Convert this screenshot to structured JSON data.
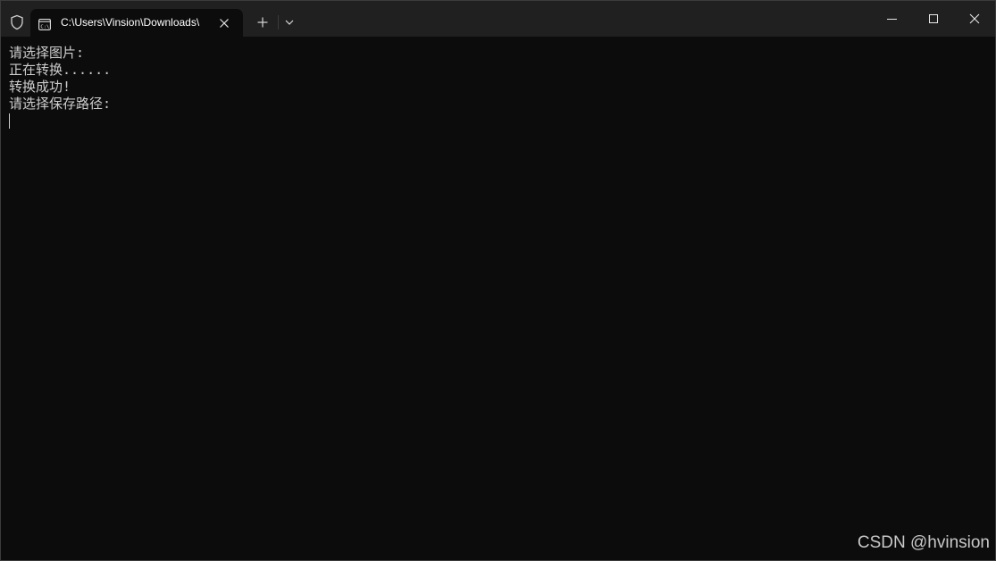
{
  "tab": {
    "title": "C:\\Users\\Vinsion\\Downloads\\"
  },
  "terminal": {
    "lines": [
      "请选择图片:",
      "正在转换......",
      "转换成功!",
      "请选择保存路径:"
    ]
  },
  "watermark": "CSDN @hvinsion",
  "icons": {
    "shield": "shield-icon",
    "tab": "terminal-icon",
    "close_tab": "close-icon",
    "new_tab": "plus-icon",
    "dropdown": "chevron-down-icon",
    "minimize": "minimize-icon",
    "maximize": "maximize-icon",
    "close_window": "close-icon"
  },
  "colors": {
    "titlebar": "#202020",
    "background": "#0c0c0c",
    "text": "#cccccc"
  }
}
